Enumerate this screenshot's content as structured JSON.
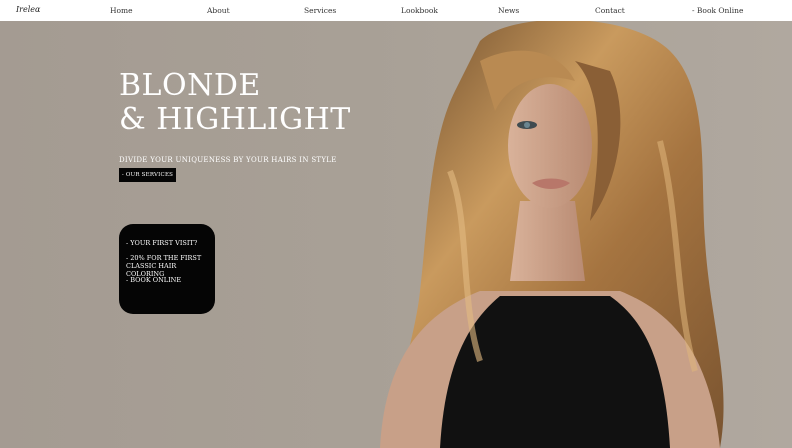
{
  "brand": {
    "logo_text": "Ireleα"
  },
  "nav": {
    "items": [
      "Home",
      "About",
      "Services",
      "Lookbook",
      "News",
      "Contact",
      "- Book Online"
    ]
  },
  "hero": {
    "title_line1": "BLONDE",
    "title_line2": "& HIGHLIGHT",
    "subtitle": "DIVIDE YOUR UNIQUENESS BY YOUR HAIRS IN STYLE",
    "cta_label": "- OUR SERVICES"
  },
  "promo": {
    "line1": "- YOUR FIRST VISIT?",
    "line2": "- 20% FOR THE FIRST\nCLASSIC HAIR COLORING",
    "line3": "- BOOK ONLINE"
  },
  "colors": {
    "background": "#a59d94",
    "accent_dark": "#050505",
    "text_light": "#ffffff"
  }
}
